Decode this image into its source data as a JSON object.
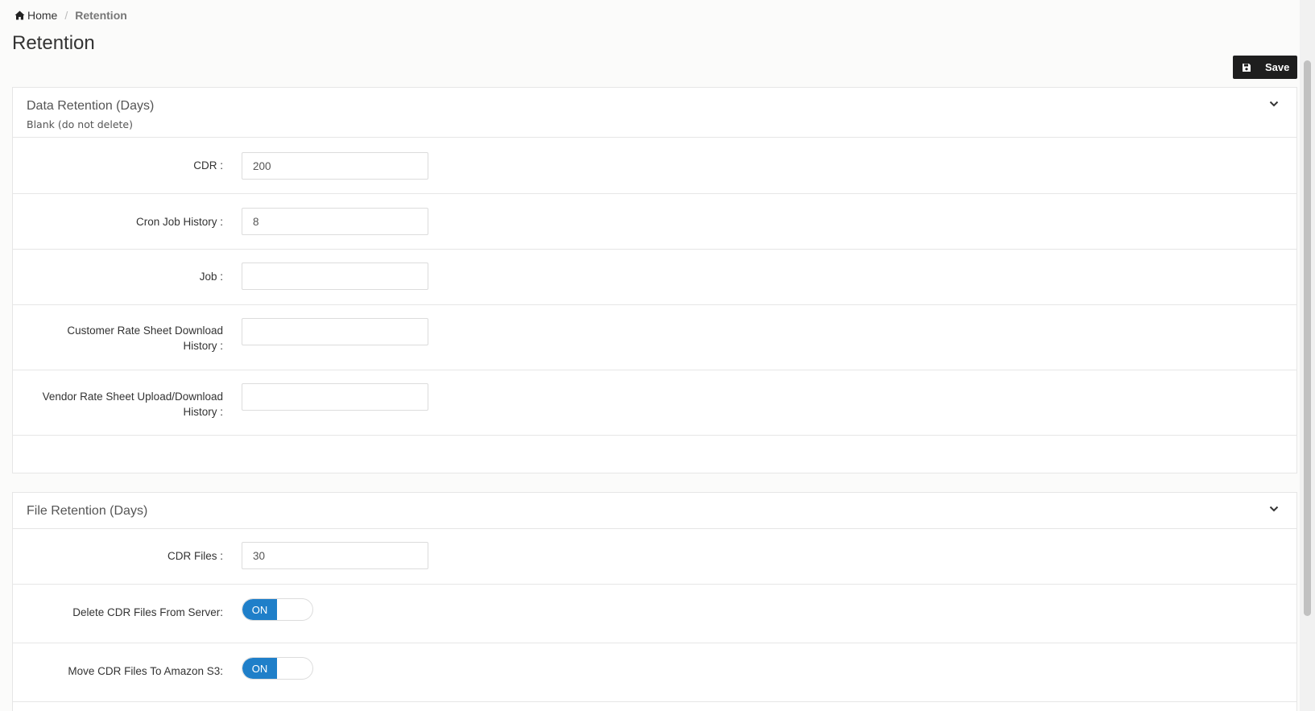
{
  "breadcrumb": {
    "home": "Home",
    "separator": "/",
    "current": "Retention"
  },
  "page_title": "Retention",
  "toolbar": {
    "save_label": "Save"
  },
  "data_retention": {
    "title": "Data Retention (Days)",
    "subtitle": "Blank (do not delete)",
    "fields": [
      {
        "label": "CDR :",
        "value": "200"
      },
      {
        "label": "Cron Job History :",
        "value": "8"
      },
      {
        "label": "Job :",
        "value": ""
      },
      {
        "label_line1": "Customer Rate Sheet Download",
        "label_line2": "History :",
        "value": ""
      },
      {
        "label_line1": "Vendor Rate Sheet Upload/Download",
        "label_line2": "History :",
        "value": ""
      }
    ]
  },
  "file_retention": {
    "title": "File Retention (Days)",
    "cdr_files": {
      "label": "CDR Files :",
      "value": "30"
    },
    "toggles": [
      {
        "label": "Delete CDR Files From Server:",
        "state": "ON"
      },
      {
        "label": "Move CDR Files To Amazon S3:",
        "state": "ON"
      }
    ]
  },
  "colors": {
    "toggle_on": "#1f7fc9",
    "save_button": "#1e1e1e",
    "background": "#fbfbfa"
  },
  "icons": {
    "home": "home-icon",
    "save": "floppy-disk-icon",
    "collapse": "chevron-down-icon"
  }
}
